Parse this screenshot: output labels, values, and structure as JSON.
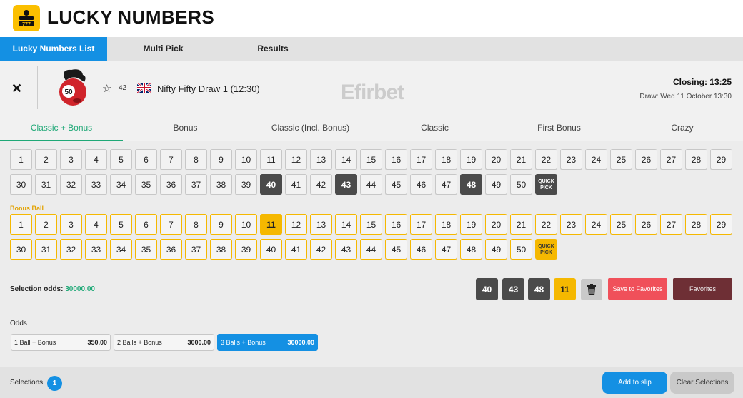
{
  "app": {
    "title": "LUCKY NUMBERS",
    "logo_icon": "slot-machine-icon",
    "accent": "#fbbf00"
  },
  "tabs": [
    {
      "label": "Lucky Numbers List",
      "active": true
    },
    {
      "label": "Multi Pick",
      "active": false
    },
    {
      "label": "Results",
      "active": false
    }
  ],
  "draw": {
    "mascot_label": "50",
    "favorite_count": "42",
    "flag": "uk-flag-icon",
    "name": "Nifty Fifty Draw 1 (12:30)",
    "watermark": "Efirbet",
    "closing": "Closing: 13:25",
    "draw_date": "Draw: Wed 11 October 13:30"
  },
  "bet_types": [
    {
      "label": "Classic + Bonus",
      "active": true
    },
    {
      "label": "Bonus",
      "active": false
    },
    {
      "label": "Classic (Incl. Bonus)",
      "active": false
    },
    {
      "label": "Classic",
      "active": false
    },
    {
      "label": "First Bonus",
      "active": false
    },
    {
      "label": "Crazy",
      "active": false
    }
  ],
  "main_grid": {
    "numbers": [
      "1",
      "2",
      "3",
      "4",
      "5",
      "6",
      "7",
      "8",
      "9",
      "10",
      "11",
      "12",
      "13",
      "14",
      "15",
      "16",
      "17",
      "18",
      "19",
      "20",
      "21",
      "22",
      "23",
      "24",
      "25",
      "26",
      "27",
      "28",
      "29",
      "30",
      "31",
      "32",
      "33",
      "34",
      "35",
      "36",
      "37",
      "38",
      "39",
      "40",
      "41",
      "42",
      "43",
      "44",
      "45",
      "46",
      "47",
      "48",
      "49",
      "50"
    ],
    "selected": [
      "40",
      "43",
      "48"
    ],
    "quick_pick_label": "QUICK PICK"
  },
  "bonus_grid": {
    "label": "Bonus Ball",
    "numbers": [
      "1",
      "2",
      "3",
      "4",
      "5",
      "6",
      "7",
      "8",
      "9",
      "10",
      "11",
      "12",
      "13",
      "14",
      "15",
      "16",
      "17",
      "18",
      "19",
      "20",
      "21",
      "22",
      "23",
      "24",
      "25",
      "26",
      "27",
      "28",
      "29",
      "30",
      "31",
      "32",
      "33",
      "34",
      "35",
      "36",
      "37",
      "38",
      "39",
      "40",
      "41",
      "42",
      "43",
      "44",
      "45",
      "46",
      "47",
      "48",
      "49",
      "50"
    ],
    "selected": [
      "11"
    ],
    "quick_pick_label": "QUICK PICK"
  },
  "selection": {
    "odds_label": "Selection odds:",
    "odds_value": "30000.00",
    "chips": [
      {
        "value": "40",
        "kind": "main"
      },
      {
        "value": "43",
        "kind": "main"
      },
      {
        "value": "48",
        "kind": "main"
      },
      {
        "value": "11",
        "kind": "bonus"
      }
    ],
    "save_label": "Save to Favorites",
    "favorites_label": "Favorites"
  },
  "odds": {
    "label": "Odds",
    "items": [
      {
        "label": "1 Ball + Bonus",
        "value": "350.00",
        "active": false
      },
      {
        "label": "2 Balls + Bonus",
        "value": "3000.00",
        "active": false
      },
      {
        "label": "3 Balls + Bonus",
        "value": "30000.00",
        "active": true
      }
    ]
  },
  "footer": {
    "selections_label": "Selections",
    "selections_count": "1",
    "add_label": "Add to slip",
    "clear_label": "Clear Selections"
  },
  "colors": {
    "blue": "#1490e3",
    "green": "#1ea876",
    "yellow": "#f5b800",
    "dark": "#4a4a4a",
    "red": "#f0505a",
    "maroon": "#6e2f35"
  }
}
